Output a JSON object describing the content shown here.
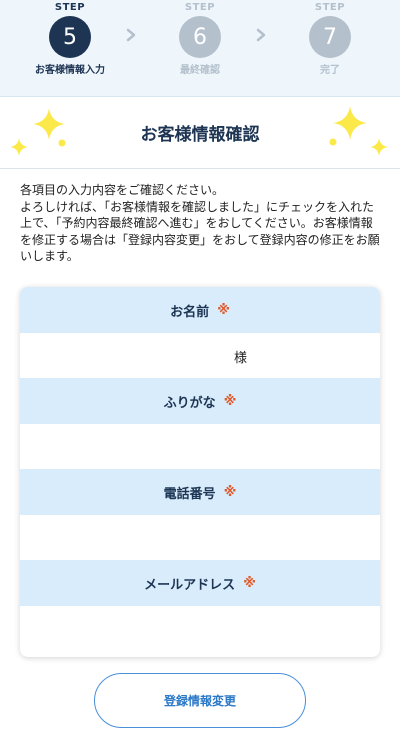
{
  "stepper": {
    "steps": [
      {
        "label": "STEP",
        "number": "5",
        "name": "お客様情報入力",
        "state": "active"
      },
      {
        "label": "STEP",
        "number": "6",
        "name": "最終確認",
        "state": "inactive"
      },
      {
        "label": "STEP",
        "number": "7",
        "name": "完了",
        "state": "inactive"
      }
    ],
    "arrow_icon": "chevron-right-icon"
  },
  "banner": {
    "title": "お客様情報確認",
    "decoration_icon": "sparkle-icon"
  },
  "intro": {
    "text": "各項目の入力内容をご確認ください。\nよろしければ、「お客様情報を確認しました」にチェックを入れた上で、「予約内容最終確認へ進む」をおしてください。お客様情報を修正する場合は「登録内容変更」をおして登録内容の修正をお願いします。"
  },
  "form": {
    "required_mark": "※",
    "fields": [
      {
        "label": "お名前",
        "value": "",
        "suffix": "様"
      },
      {
        "label": "ふりがな",
        "value": ""
      },
      {
        "label": "電話番号",
        "value": ""
      },
      {
        "label": "メールアドレス",
        "value": ""
      }
    ]
  },
  "actions": {
    "edit_label": "登録情報変更"
  },
  "colors": {
    "navy": "#1d3553",
    "inactive": "#b4c0cc",
    "field_header_bg": "#d8ecfb",
    "required": "#e05a2b",
    "sparkle": "#fbe94a",
    "button_border": "#4a90d9"
  }
}
